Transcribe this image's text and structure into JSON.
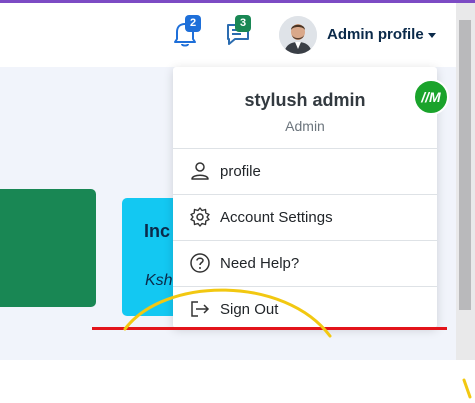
{
  "header": {
    "notifications": {
      "icon": "bell-icon",
      "count": "2",
      "badge_color": "#1e6fd9"
    },
    "messages": {
      "icon": "message-icon",
      "count": "3",
      "badge_color": "#198754"
    },
    "profile": {
      "label": "Admin profile",
      "avatar": "avatar-photo"
    }
  },
  "dashboard": {
    "card_title": "Inc",
    "card_subtitle": "Ksh",
    "colors": {
      "green_card": "#198754",
      "cyan_card": "#13c8f2"
    }
  },
  "dropdown": {
    "user_name": "stylush admin",
    "user_role": "Admin",
    "items": [
      {
        "label": "profile",
        "icon": "user-icon"
      },
      {
        "label": "Account Settings",
        "icon": "gear-icon"
      },
      {
        "label": "Need Help?",
        "icon": "question-icon"
      },
      {
        "label": "Sign Out",
        "icon": "sign-out-icon"
      }
    ]
  },
  "badge_logo": {
    "text": "//M",
    "color": "#1aa32b"
  },
  "annotation": {
    "line_color": "#e3141b",
    "arc_color": "#f2c811"
  }
}
